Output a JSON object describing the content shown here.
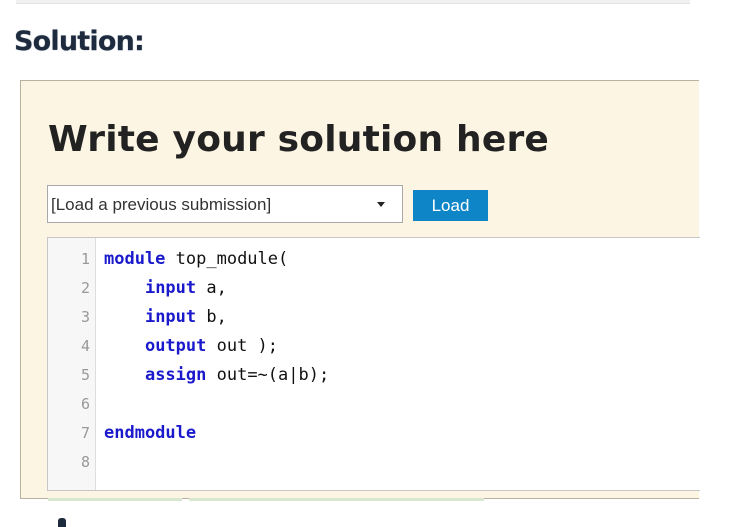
{
  "section": {
    "heading": "Solution:"
  },
  "panel": {
    "title": "Write your solution here",
    "submission_select": {
      "selected": "[Load a previous submission]"
    },
    "load_button": "Load"
  },
  "editor": {
    "language": "verilog",
    "lines": [
      {
        "number": "1",
        "indent": "",
        "keyword": "module",
        "rest": " top_module("
      },
      {
        "number": "2",
        "indent": "    ",
        "keyword": "input",
        "rest": " a,"
      },
      {
        "number": "3",
        "indent": "    ",
        "keyword": "input",
        "rest": " b,"
      },
      {
        "number": "4",
        "indent": "    ",
        "keyword": "output",
        "rest": " out );"
      },
      {
        "number": "5",
        "indent": "    ",
        "keyword": "assign",
        "rest": " out=~(a|b);"
      },
      {
        "number": "6",
        "indent": "",
        "keyword": "",
        "rest": ""
      },
      {
        "number": "7",
        "indent": "",
        "keyword": "endmodule",
        "rest": ""
      },
      {
        "number": "8",
        "indent": "",
        "keyword": "",
        "rest": ""
      }
    ]
  },
  "colors": {
    "panel_bg": "#fcf5e3",
    "keyword": "#1a1acc",
    "button": "#0e85c7"
  }
}
